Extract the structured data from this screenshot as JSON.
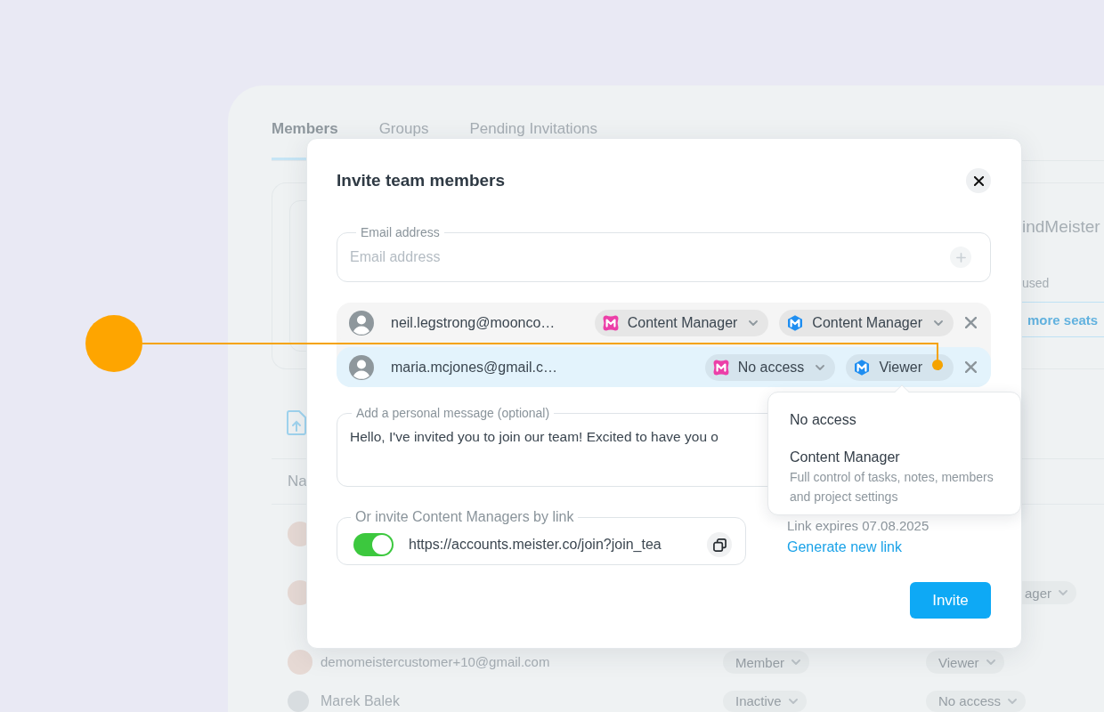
{
  "background": {
    "tabs": [
      {
        "label": "Members",
        "selected": true
      },
      {
        "label": "Groups",
        "selected": false
      },
      {
        "label": "Pending Invitations",
        "selected": false
      }
    ],
    "plan_card": {
      "title": "indMeister",
      "note": "used",
      "button": "more seats"
    },
    "table": {
      "column_1": "Na",
      "rows": [
        {
          "kind": "photo"
        },
        {
          "kind": "photo",
          "access": "ager"
        },
        {
          "kind": "photo",
          "email": "demomeistercustomer+10@gmail.com",
          "role": "Member",
          "access": "Viewer"
        },
        {
          "kind": "initials",
          "name": "Marek Balek",
          "role": "Inactive",
          "access": "No access"
        }
      ]
    }
  },
  "dialog": {
    "title": "Invite team members",
    "email_field": {
      "label": "Email address",
      "placeholder": "Email address"
    },
    "invitees": [
      {
        "email": "neil.legstrong@moonco…",
        "selected": false,
        "roles": [
          {
            "kind": "tile",
            "label": "Content Manager"
          },
          {
            "kind": "hexagon",
            "label": "Content Manager"
          }
        ]
      },
      {
        "email": "maria.mcjones@gmail.c…",
        "selected": true,
        "roles": [
          {
            "kind": "tile",
            "label": "No access"
          },
          {
            "kind": "hexagon",
            "label": "Viewer"
          }
        ]
      }
    ],
    "message_field": {
      "label": "Add a personal message (optional)",
      "value": "Hello, I've invited you to join our team! Excited to have you o"
    },
    "link_field": {
      "label": "Or invite Content Managers by link",
      "enabled": true,
      "value": "https://accounts.meister.co/join?join_tea"
    },
    "link_expiry": "Link expires 07.08.2025",
    "generate_link": "Generate new link",
    "invite_button": "Invite",
    "role_menu": {
      "options": [
        {
          "label": "No access",
          "selected": false
        },
        {
          "label": "Content Manager",
          "description": "Full control of tasks, notes, members and project settings",
          "selected": false
        }
      ]
    }
  }
}
